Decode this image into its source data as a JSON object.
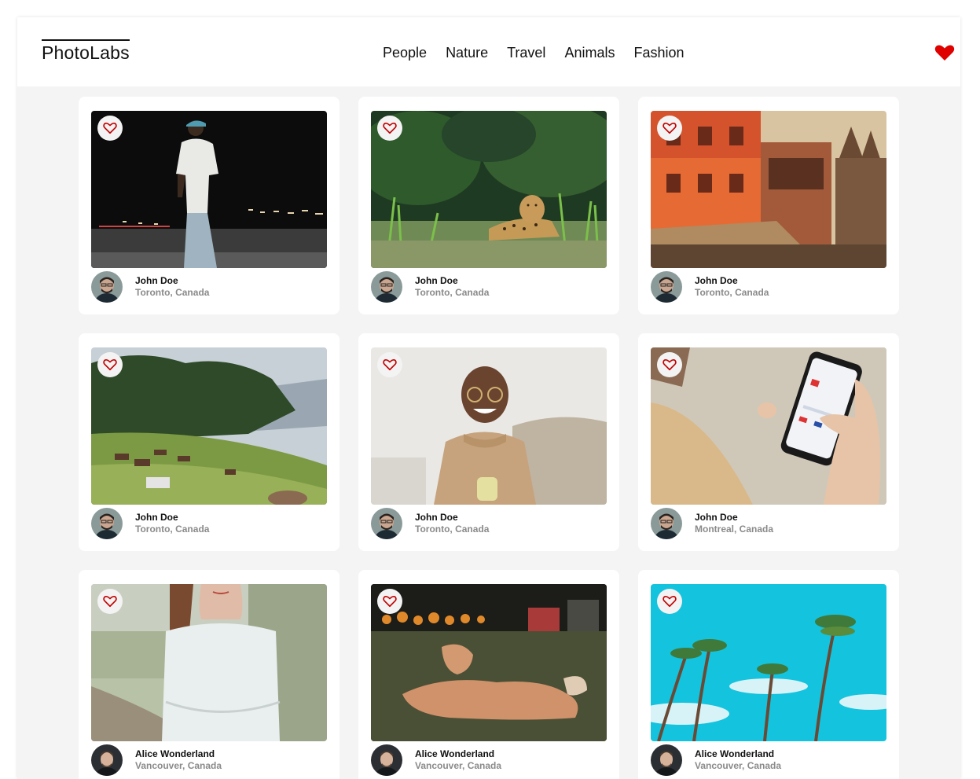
{
  "nav": {
    "logo": "PhotoLabs",
    "topics": [
      "People",
      "Nature",
      "Travel",
      "Animals",
      "Fashion"
    ],
    "fav_icon": "heart-icon",
    "accent": "#df0000"
  },
  "photos": [
    {
      "user": "John Doe",
      "location": "Toronto, Canada",
      "subject": "man-walking-night"
    },
    {
      "user": "John Doe",
      "location": "Toronto, Canada",
      "subject": "leopard-in-grass"
    },
    {
      "user": "John Doe",
      "location": "Toronto, Canada",
      "subject": "colorful-buildings"
    },
    {
      "user": "John Doe",
      "location": "Toronto, Canada",
      "subject": "horses-grazing-hillside"
    },
    {
      "user": "John Doe",
      "location": "Toronto, Canada",
      "subject": "smiling-man-with-mug"
    },
    {
      "user": "John Doe",
      "location": "Montreal, Canada",
      "subject": "hand-holding-phone"
    },
    {
      "user": "Alice Wonderland",
      "location": "Vancouver, Canada",
      "subject": "woman-white-top"
    },
    {
      "user": "Alice Wonderland",
      "location": "Vancouver, Canada",
      "subject": "dog-lying-on-grass"
    },
    {
      "user": "Alice Wonderland",
      "location": "Vancouver, Canada",
      "subject": "palm-trees-blue-sky"
    }
  ]
}
